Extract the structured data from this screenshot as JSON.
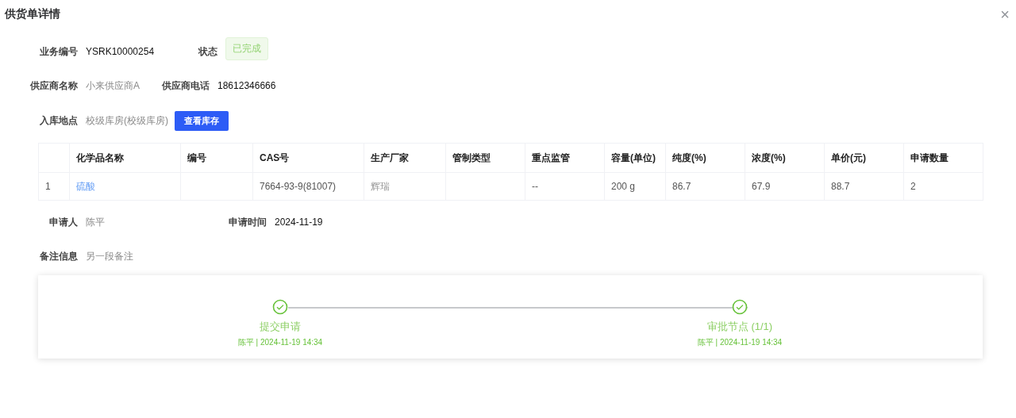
{
  "dialog": {
    "title": "供货单详情",
    "close": "×"
  },
  "field_rows": [
    [
      {
        "label": "业务编号",
        "value": "YSRK10000254",
        "kind": "text"
      },
      {
        "label": "状态",
        "value": "已完成",
        "kind": "tag"
      }
    ],
    [
      {
        "label": "供应商名称",
        "value": "小来供应商A",
        "kind": "muted"
      },
      {
        "label": "供应商电话",
        "value": "18612346666",
        "kind": "text"
      }
    ],
    [
      {
        "label": "入库地点",
        "value": "校级库房(校级库房)",
        "kind": "muted"
      },
      {
        "value": "查看库存",
        "kind": "button"
      }
    ]
  ],
  "table": {
    "columns": [
      "化学品名称",
      "编号",
      "CAS号",
      "生产厂家",
      "管制类型",
      "重点监管",
      "容量(单位)",
      "纯度(%)",
      "浓度(%)",
      "单价(元)",
      "申请数量"
    ],
    "rows": [
      {
        "index": "1",
        "cells": [
          {
            "text": "硫酸",
            "kind": "link"
          },
          null,
          {
            "text": "7664-93-9(81007)",
            "kind": "plain"
          },
          {
            "text": "辉瑞",
            "kind": "muted"
          },
          null,
          {
            "text": "--",
            "kind": "plain"
          },
          {
            "text": "200 g",
            "kind": "plain"
          },
          {
            "text": "86.7",
            "kind": "plain"
          },
          {
            "text": "67.9",
            "kind": "plain"
          },
          {
            "text": "88.7",
            "kind": "plain"
          },
          {
            "text": "2",
            "kind": "plain"
          }
        ]
      }
    ]
  },
  "footer_rows": [
    [
      {
        "label": "申请人",
        "value": "陈平",
        "kind": "muted"
      },
      {
        "label": "申请时间",
        "value": "2024-11-19",
        "kind": "text"
      }
    ],
    [
      {
        "label": "备注信息",
        "value": "另一段备注",
        "kind": "muted"
      }
    ]
  ],
  "steps": [
    {
      "title": "提交申请",
      "meta": "陈平 | 2024-11-19 14:34",
      "done": true
    },
    {
      "title": "审批节点 (1/1)",
      "meta": "陈平 | 2024-11-19 14:34",
      "done": true
    }
  ]
}
